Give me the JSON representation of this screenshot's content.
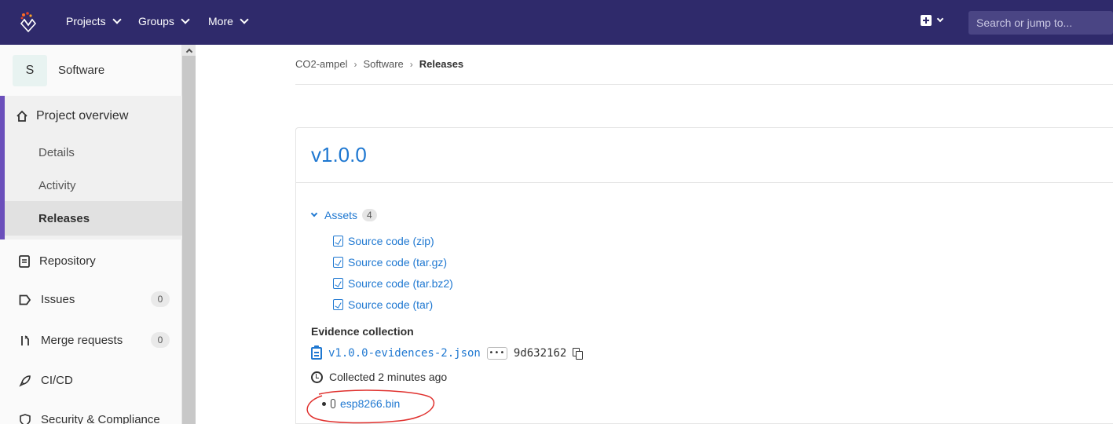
{
  "topbar": {
    "nav": [
      {
        "label": "Projects"
      },
      {
        "label": "Groups"
      },
      {
        "label": "More"
      }
    ],
    "search_placeholder": "Search or jump to...",
    "colors": {
      "background": "#2f2a6b",
      "search": "#4a4584"
    }
  },
  "sidebar": {
    "project_initial": "S",
    "project_name": "Software",
    "overview_label": "Project overview",
    "sub_items": [
      "Details",
      "Activity",
      "Releases"
    ],
    "items": [
      {
        "label": "Repository"
      },
      {
        "label": "Issues",
        "count": "0"
      },
      {
        "label": "Merge requests",
        "count": "0"
      },
      {
        "label": "CI/CD"
      },
      {
        "label": "Security & Compliance"
      }
    ]
  },
  "breadcrumb": {
    "items": [
      "CO2-ampel",
      "Software"
    ],
    "current": "Releases"
  },
  "release": {
    "title": "v1.0.0",
    "assets_label": "Assets",
    "assets_count": "4",
    "assets": [
      "Source code (zip)",
      "Source code (tar.gz)",
      "Source code (tar.bz2)",
      "Source code (tar)"
    ],
    "evidence_title": "Evidence collection",
    "evidence_file": "v1.0.0-evidences-2.json",
    "evidence_ellipsis": "•••",
    "evidence_sha": "9d632162",
    "collected_text": "Collected 2 minutes ago",
    "bin_file": "esp8266.bin",
    "link_color": "#1f78d1",
    "annotation_color": "#e0312e"
  }
}
